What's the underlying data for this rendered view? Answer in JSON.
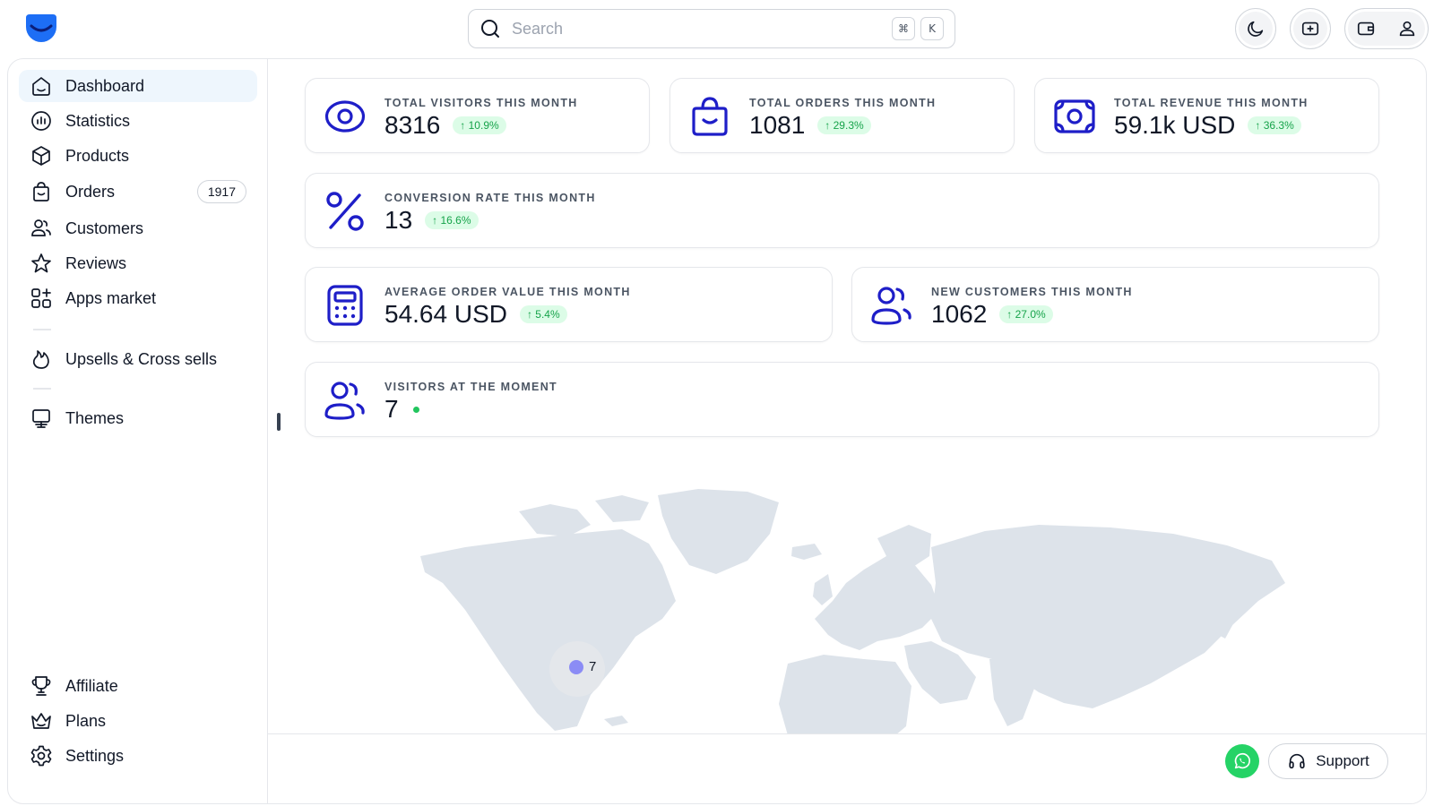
{
  "search": {
    "placeholder": "Search",
    "shortcut_mod": "⌘",
    "shortcut_key": "K"
  },
  "sidebar": {
    "items": [
      {
        "label": "Dashboard",
        "icon": "home-icon",
        "active": true
      },
      {
        "label": "Statistics",
        "icon": "chart-icon"
      },
      {
        "label": "Products",
        "icon": "box-icon"
      },
      {
        "label": "Orders",
        "icon": "bag-icon",
        "badge": "1917"
      },
      {
        "label": "Customers",
        "icon": "users-icon"
      },
      {
        "label": "Reviews",
        "icon": "star-icon"
      },
      {
        "label": "Apps market",
        "icon": "apps-icon"
      },
      {
        "label": "Upsells & Cross sells",
        "icon": "flame-icon"
      },
      {
        "label": "Themes",
        "icon": "easel-icon"
      }
    ],
    "bottom": [
      {
        "label": "Affiliate",
        "icon": "trophy-icon"
      },
      {
        "label": "Plans",
        "icon": "crown-icon"
      },
      {
        "label": "Settings",
        "icon": "gear-icon"
      }
    ]
  },
  "stats": [
    {
      "label": "TOTAL VISITORS THIS MONTH",
      "value": "8316",
      "change": "↑ 10.9%",
      "icon": "eye-icon"
    },
    {
      "label": "TOTAL ORDERS THIS MONTH",
      "value": "1081",
      "change": "↑ 29.3%",
      "icon": "bag-icon"
    },
    {
      "label": "TOTAL REVENUE THIS MONTH",
      "value": "59.1k USD",
      "change": "↑ 36.3%",
      "icon": "money-icon"
    },
    {
      "label": "CONVERSION RATE THIS MONTH",
      "value": "13",
      "change": "↑ 16.6%",
      "icon": "percent-icon"
    },
    {
      "label": "AVERAGE ORDER VALUE THIS MONTH",
      "value": "54.64 USD",
      "change": "↑ 5.4%",
      "icon": "calculator-icon"
    },
    {
      "label": "NEW CUSTOMERS THIS MONTH",
      "value": "1062",
      "change": "↑ 27.0%",
      "icon": "users-icon"
    },
    {
      "label": "VISITORS AT THE MOMENT",
      "value": "7",
      "icon": "users-icon"
    }
  ],
  "map": {
    "marker_count": "7"
  },
  "footer": {
    "support_label": "Support"
  },
  "colors": {
    "accent": "#1e1ec8",
    "logo": "#1d6ef5",
    "success": "#16a34a",
    "success_bg": "#dcfce7",
    "map_land": "#dde3ea",
    "marker": "#8b8cf5",
    "whatsapp": "#25d366"
  }
}
